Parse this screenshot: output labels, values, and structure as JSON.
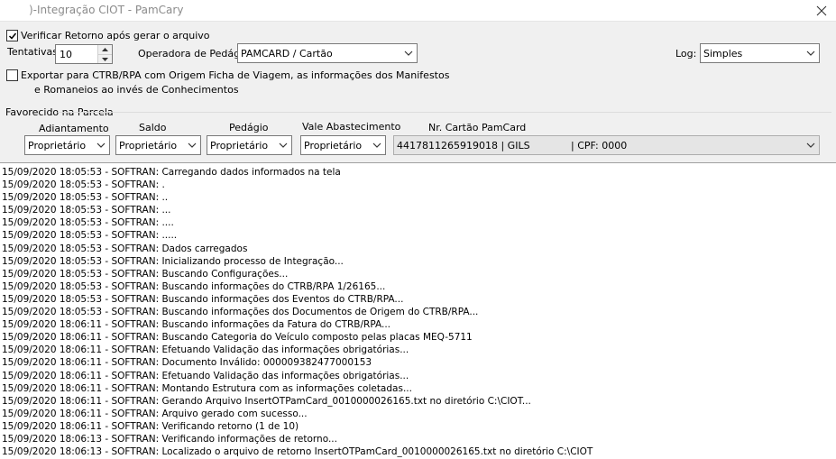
{
  "window": {
    "title": ")-Integração CIOT - PamCary"
  },
  "options": {
    "verify_return_label": "Verificar Retorno após gerar o arquivo",
    "verify_return_checked": true,
    "attempts_label": "Tentativas",
    "attempts_value": "10",
    "toll_operator_label": "Operadora de Pedágio",
    "toll_operator_value": "PAMCARD / Cartão",
    "log_label": "Log:",
    "log_value": "Simples",
    "export_line1": "Exportar para CTRB/RPA com Origem Ficha de Viagem, as informações dos Manifestos",
    "export_line2": "e Romaneios ao invés de Conhecimentos",
    "export_checked": false
  },
  "favored": {
    "group_label": "Favorecido na Parcela",
    "adiantamento_label": "Adiantamento",
    "adiantamento_value": "Proprietário",
    "saldo_label": "Saldo",
    "saldo_value": "Proprietário",
    "pedagio_label": "Pedágio",
    "pedagio_value": "Proprietário",
    "vale_label": "Vale Abastecimento",
    "vale_value": "Proprietário",
    "cartao_label": "Nr. Cartão PamCard",
    "cartao_value": "4417811265919018 | GILS",
    "cartao_cpf": "| CPF: 0000"
  },
  "log_lines": [
    "15/09/2020 18:05:53 - SOFTRAN: Carregando dados informados na tela",
    "15/09/2020 18:05:53 - SOFTRAN: .",
    "15/09/2020 18:05:53 - SOFTRAN: ..",
    "15/09/2020 18:05:53 - SOFTRAN: ...",
    "15/09/2020 18:05:53 - SOFTRAN: ....",
    "15/09/2020 18:05:53 - SOFTRAN: .....",
    "15/09/2020 18:05:53 - SOFTRAN: Dados carregados",
    "15/09/2020 18:05:53 - SOFTRAN: Inicializando processo de Integração...",
    "15/09/2020 18:05:53 - SOFTRAN: Buscando Configurações...",
    "15/09/2020 18:05:53 - SOFTRAN: Buscando informações do CTRB/RPA 1/26165...",
    "15/09/2020 18:05:53 - SOFTRAN: Buscando informações dos Eventos do CTRB/RPA...",
    "15/09/2020 18:05:53 - SOFTRAN: Buscando informações dos Documentos de Origem do CTRB/RPA...",
    "15/09/2020 18:06:11 - SOFTRAN: Buscando informações da Fatura do CTRB/RPA...",
    "15/09/2020 18:06:11 - SOFTRAN: Buscando Categoria do Veículo composto pelas placas MEQ-5711",
    "15/09/2020 18:06:11 - SOFTRAN: Efetuando Validação das informações obrigatórias...",
    "15/09/2020 18:06:11 - SOFTRAN: Documento Inválido: 000009382477000153",
    "15/09/2020 18:06:11 - SOFTRAN: Efetuando Validação das informações obrigatórias...",
    "15/09/2020 18:06:11 - SOFTRAN: Montando Estrutura com as informações coletadas...",
    "15/09/2020 18:06:11 - SOFTRAN: Gerando Arquivo InsertOTPamCard_0010000026165.txt no diretório C:\\CIOT...",
    "15/09/2020 18:06:11 - SOFTRAN: Arquivo gerado com sucesso...",
    "15/09/2020 18:06:11 - SOFTRAN: Verificando retorno (1 de 10)",
    "15/09/2020 18:06:13 - SOFTRAN: Verificando informações de retorno...",
    "15/09/2020 18:06:13 - SOFTRAN: Localizado o arquivo de retorno InsertOTPamCard_0010000026165.txt no diretório C:\\CIOT"
  ]
}
